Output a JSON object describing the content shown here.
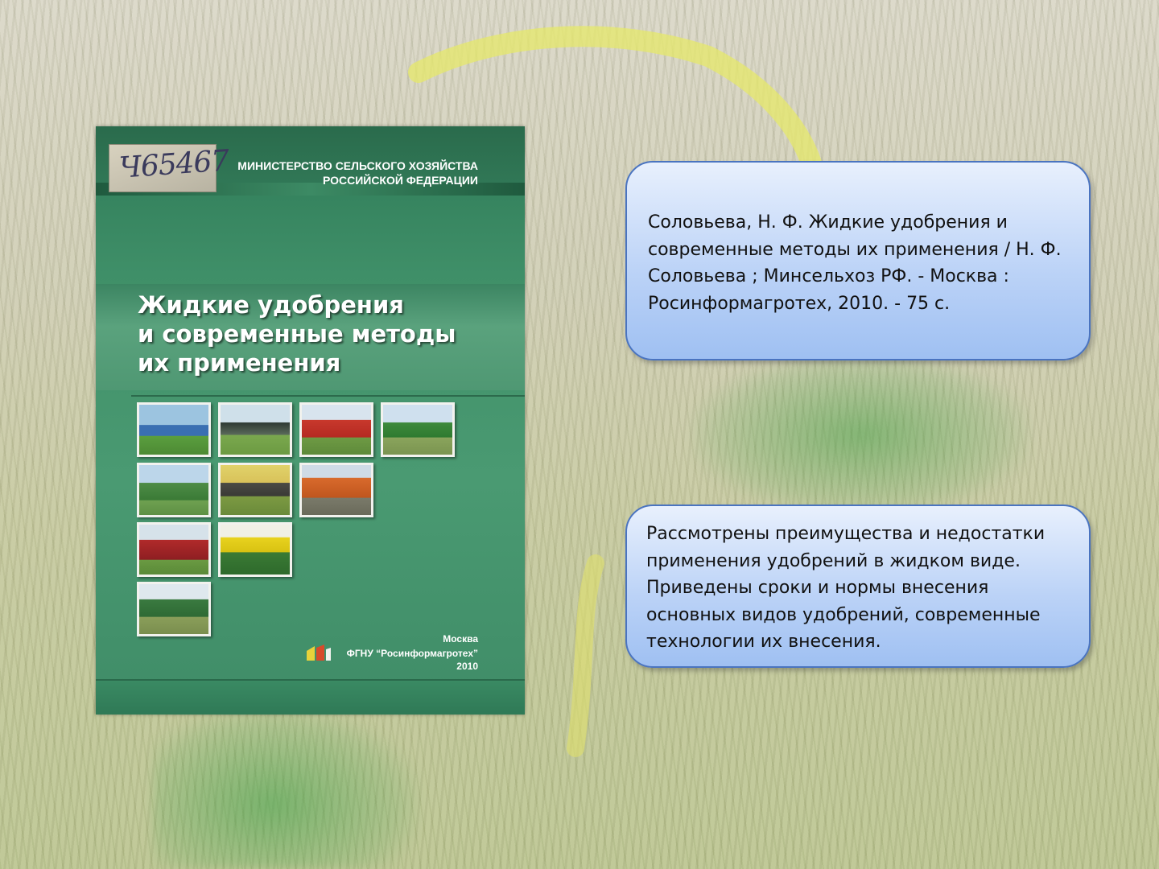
{
  "cover": {
    "stamp_number": "Ч65467",
    "ministry_line1": "МИНИСТЕРСТВО СЕЛЬСКОГО ХОЗЯЙСТВА",
    "ministry_line2": "РОССИЙСКОЙ ФЕДЕРАЦИИ",
    "title_line1": "Жидкие удобрения",
    "title_line2": "и современные методы",
    "title_line3": "их применения",
    "city": "Москва",
    "publisher": "ФГНУ “Росинформагротех”",
    "year": "2010"
  },
  "citation": {
    "text": "Соловьева, Н. Ф. Жидкие удобрения и современные методы их применения / Н. Ф. Соловьева ; Минсельхоз РФ. - Москва : Росинформагротех, 2010. - 75 с."
  },
  "summary": {
    "text": "Рассмотрены преимущества и недостатки применения удобрений в жидком виде. Приведены сроки и нормы внесения основных видов удобрений, современные технологии их внесения."
  },
  "colors": {
    "cover_green": "#3f8f68",
    "box_border": "#4a74c0",
    "box_fill": "#bcd3f7"
  }
}
